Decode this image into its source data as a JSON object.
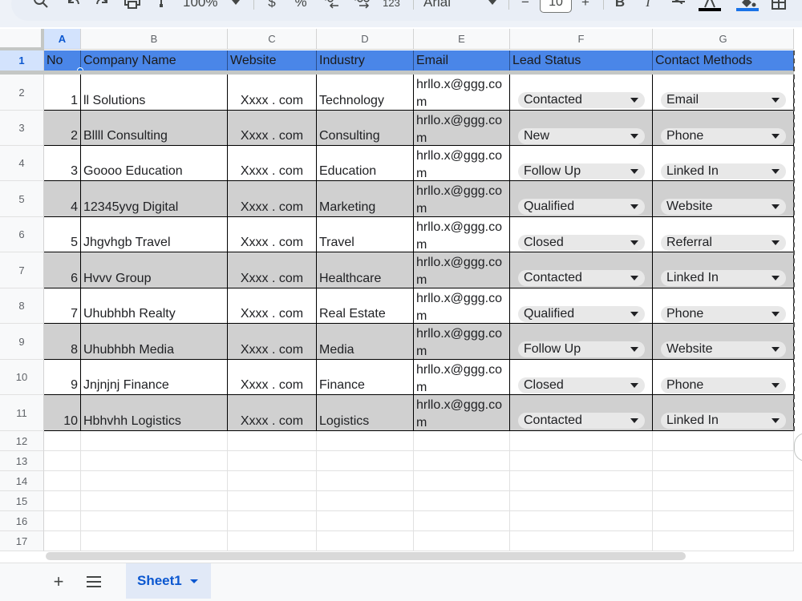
{
  "toolbar": {
    "zoom": "100%",
    "currency": "$",
    "percent": "%",
    "number_format": "123",
    "font": "Arial",
    "font_size": "10",
    "minus": "−",
    "plus": "+",
    "bold": "B",
    "italic": "I"
  },
  "columns": [
    "A",
    "B",
    "C",
    "D",
    "E",
    "F",
    "G"
  ],
  "row_numbers": [
    "1",
    "2",
    "3",
    "4",
    "5",
    "6",
    "7",
    "8",
    "9",
    "10",
    "11",
    "12",
    "13",
    "14",
    "15",
    "16",
    "17"
  ],
  "header": [
    "No",
    "Company Name",
    "Website",
    "Industry",
    "Email",
    "Lead Status",
    "Contact Methods"
  ],
  "rows": [
    {
      "no": "1",
      "company": "ll Solutions",
      "website": "Xxxx . com",
      "industry": "Technology",
      "email": "hrllo.x@ggg.com",
      "status": "Contacted",
      "method": "Email"
    },
    {
      "no": "2",
      "company": "Bllll Consulting",
      "website": "Xxxx . com",
      "industry": "Consulting",
      "email": "hrllo.x@ggg.com",
      "status": "New",
      "method": "Phone"
    },
    {
      "no": "3",
      "company": "Goooo Education",
      "website": "Xxxx . com",
      "industry": "Education",
      "email": "hrllo.x@ggg.com",
      "status": "Follow Up",
      "method": "Linked In"
    },
    {
      "no": "4",
      "company": "12345yvg Digital",
      "website": "Xxxx . com",
      "industry": "Marketing",
      "email": "hrllo.x@ggg.com",
      "status": "Qualified",
      "method": "Website"
    },
    {
      "no": "5",
      "company": "Jhgvhgb Travel",
      "website": "Xxxx . com",
      "industry": "Travel",
      "email": "hrllo.x@ggg.com",
      "status": "Closed",
      "method": "Referral"
    },
    {
      "no": "6",
      "company": "Hvvv Group",
      "website": "Xxxx . com",
      "industry": "Healthcare",
      "email": "hrllo.x@ggg.com",
      "status": "Contacted",
      "method": "Linked In"
    },
    {
      "no": "7",
      "company": "Uhubhbh Realty",
      "website": "Xxxx . com",
      "industry": "Real Estate",
      "email": "hrllo.x@ggg.com",
      "status": "Qualified",
      "method": "Phone"
    },
    {
      "no": "8",
      "company": "Uhubhbh Media",
      "website": "Xxxx . com",
      "industry": "Media",
      "email": "hrllo.x@ggg.com",
      "status": "Follow Up",
      "method": "Website"
    },
    {
      "no": "9",
      "company": "Jnjnjnj Finance",
      "website": "Xxxx . com",
      "industry": "Finance",
      "email": "hrllo.x@ggg.com",
      "status": "Closed",
      "method": "Phone"
    },
    {
      "no": "10",
      "company": "Hbhvhh Logistics",
      "website": "Xxxx . com",
      "industry": "Logistics",
      "email": "hrllo.x@ggg.com",
      "status": "Contacted",
      "method": "Linked In"
    }
  ],
  "sheet_tab": "Sheet1",
  "add_sheet": "+",
  "colors": {
    "header_fill": "#4a86e8",
    "stripe_fill": "#d0d0d0",
    "accent": "#0b57d0"
  }
}
